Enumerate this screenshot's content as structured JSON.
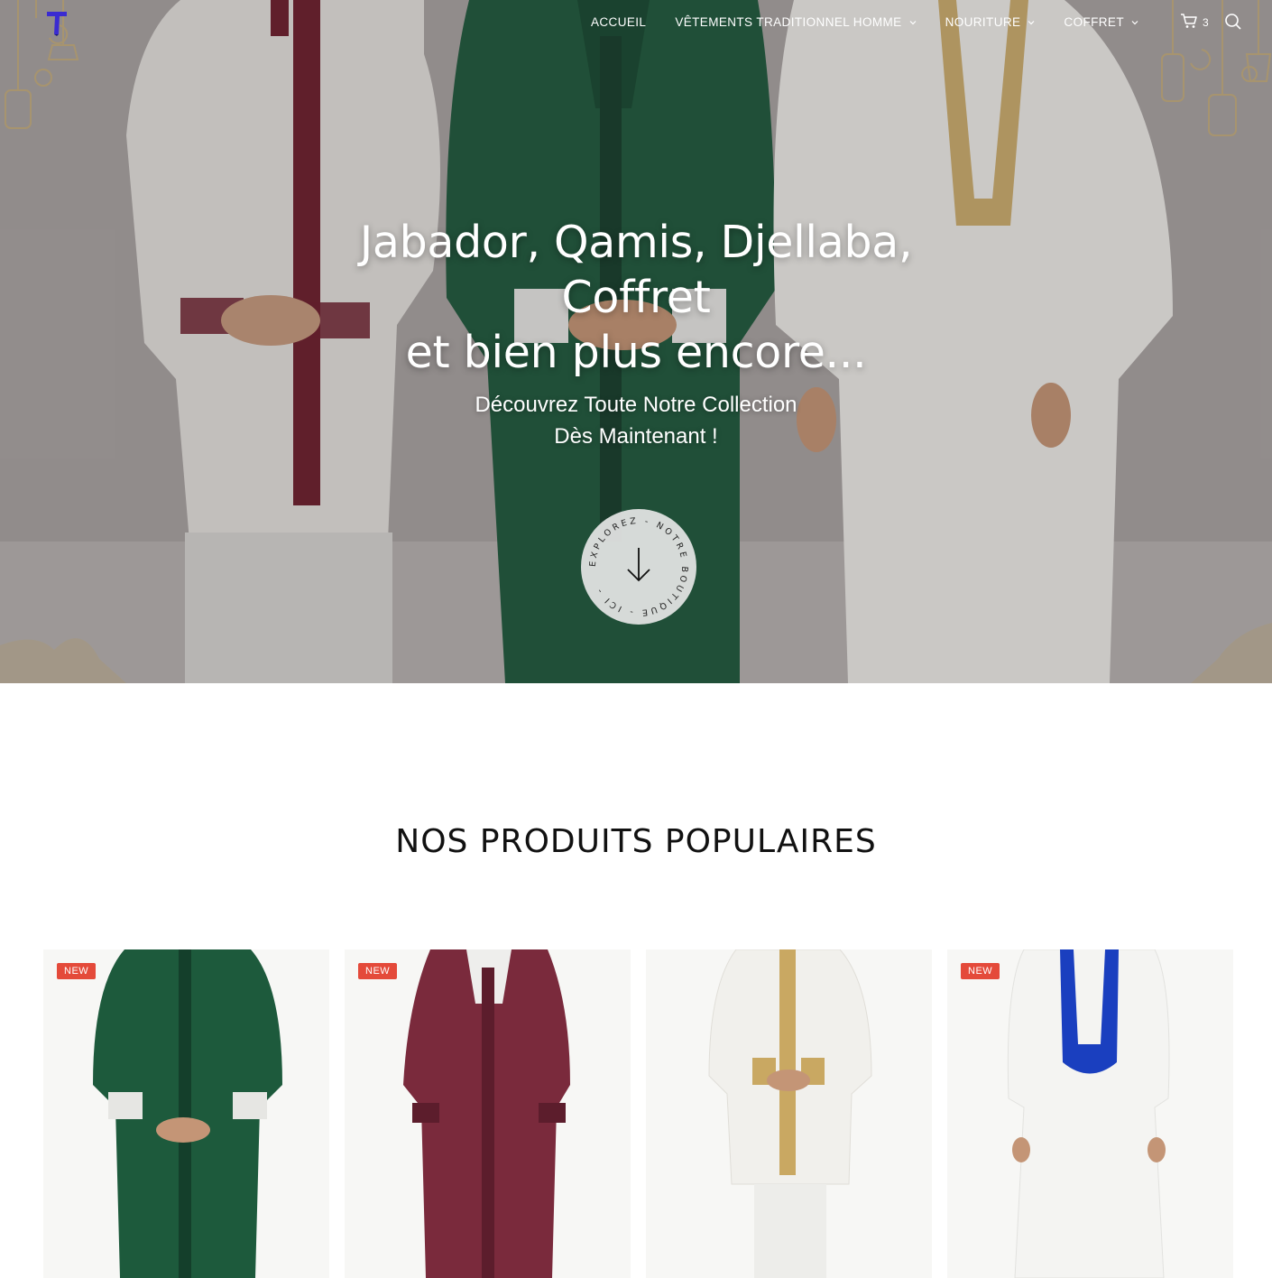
{
  "header": {
    "logo_letter": "T",
    "nav": [
      {
        "label": "ACCUEIL",
        "has_dropdown": false
      },
      {
        "label": "VÊTEMENTS TRADITIONNEL HOMME",
        "has_dropdown": true
      },
      {
        "label": "NOURITURE",
        "has_dropdown": true
      },
      {
        "label": "COFFRET",
        "has_dropdown": true
      }
    ],
    "cart_count": "3",
    "icons": {
      "cart": "cart-icon",
      "search": "search-icon"
    }
  },
  "hero": {
    "title_line1": "Jabador, Qamis, Djellaba,",
    "title_line2": "Coffret",
    "title_line3": "et bien plus encore...",
    "subtitle_line1": "Découvrez Toute Notre Collection",
    "subtitle_line2": "Dès Maintenant !",
    "explore_text": "EXPLOREZ - NOTRE BOUTIQUE - ICI -"
  },
  "section": {
    "title": "NOS PRODUITS POPULAIRES"
  },
  "products": [
    {
      "badge": "NEW",
      "color": "#1d5a3c"
    },
    {
      "badge": "NEW",
      "color": "#7a2a3c"
    },
    {
      "badge": "",
      "color": "#f2f1ee"
    },
    {
      "badge": "NEW",
      "color": "#f4f4f2"
    }
  ],
  "colors": {
    "badge": "#e44a3a",
    "hero_text": "#ffffff",
    "logo": "#3a2bd1"
  }
}
